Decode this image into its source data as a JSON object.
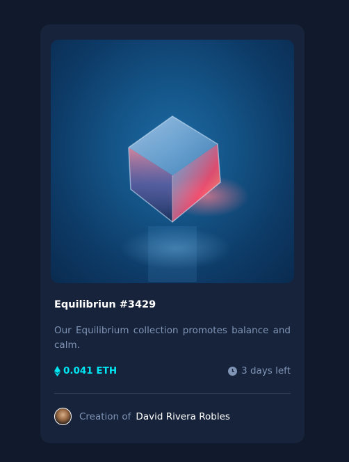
{
  "card": {
    "image_alt": "Equilibrium crystal cube",
    "title": "Equilibriun #3429",
    "description": "Our Equilibrium collection promotes balance and calm.",
    "price": "0.041 ETH",
    "time_left": "3 days left",
    "creator_prefix": "Creation of",
    "creator_name": "David Rivera Robles"
  },
  "colors": {
    "page_bg": "#111a2c",
    "card_bg": "#16233a",
    "accent_cyan": "#00e6f2",
    "muted_text": "#8094b6",
    "divider": "#2c3b58"
  },
  "icons": {
    "price": "ethereum-icon",
    "time": "clock-icon",
    "creator": "avatar"
  }
}
